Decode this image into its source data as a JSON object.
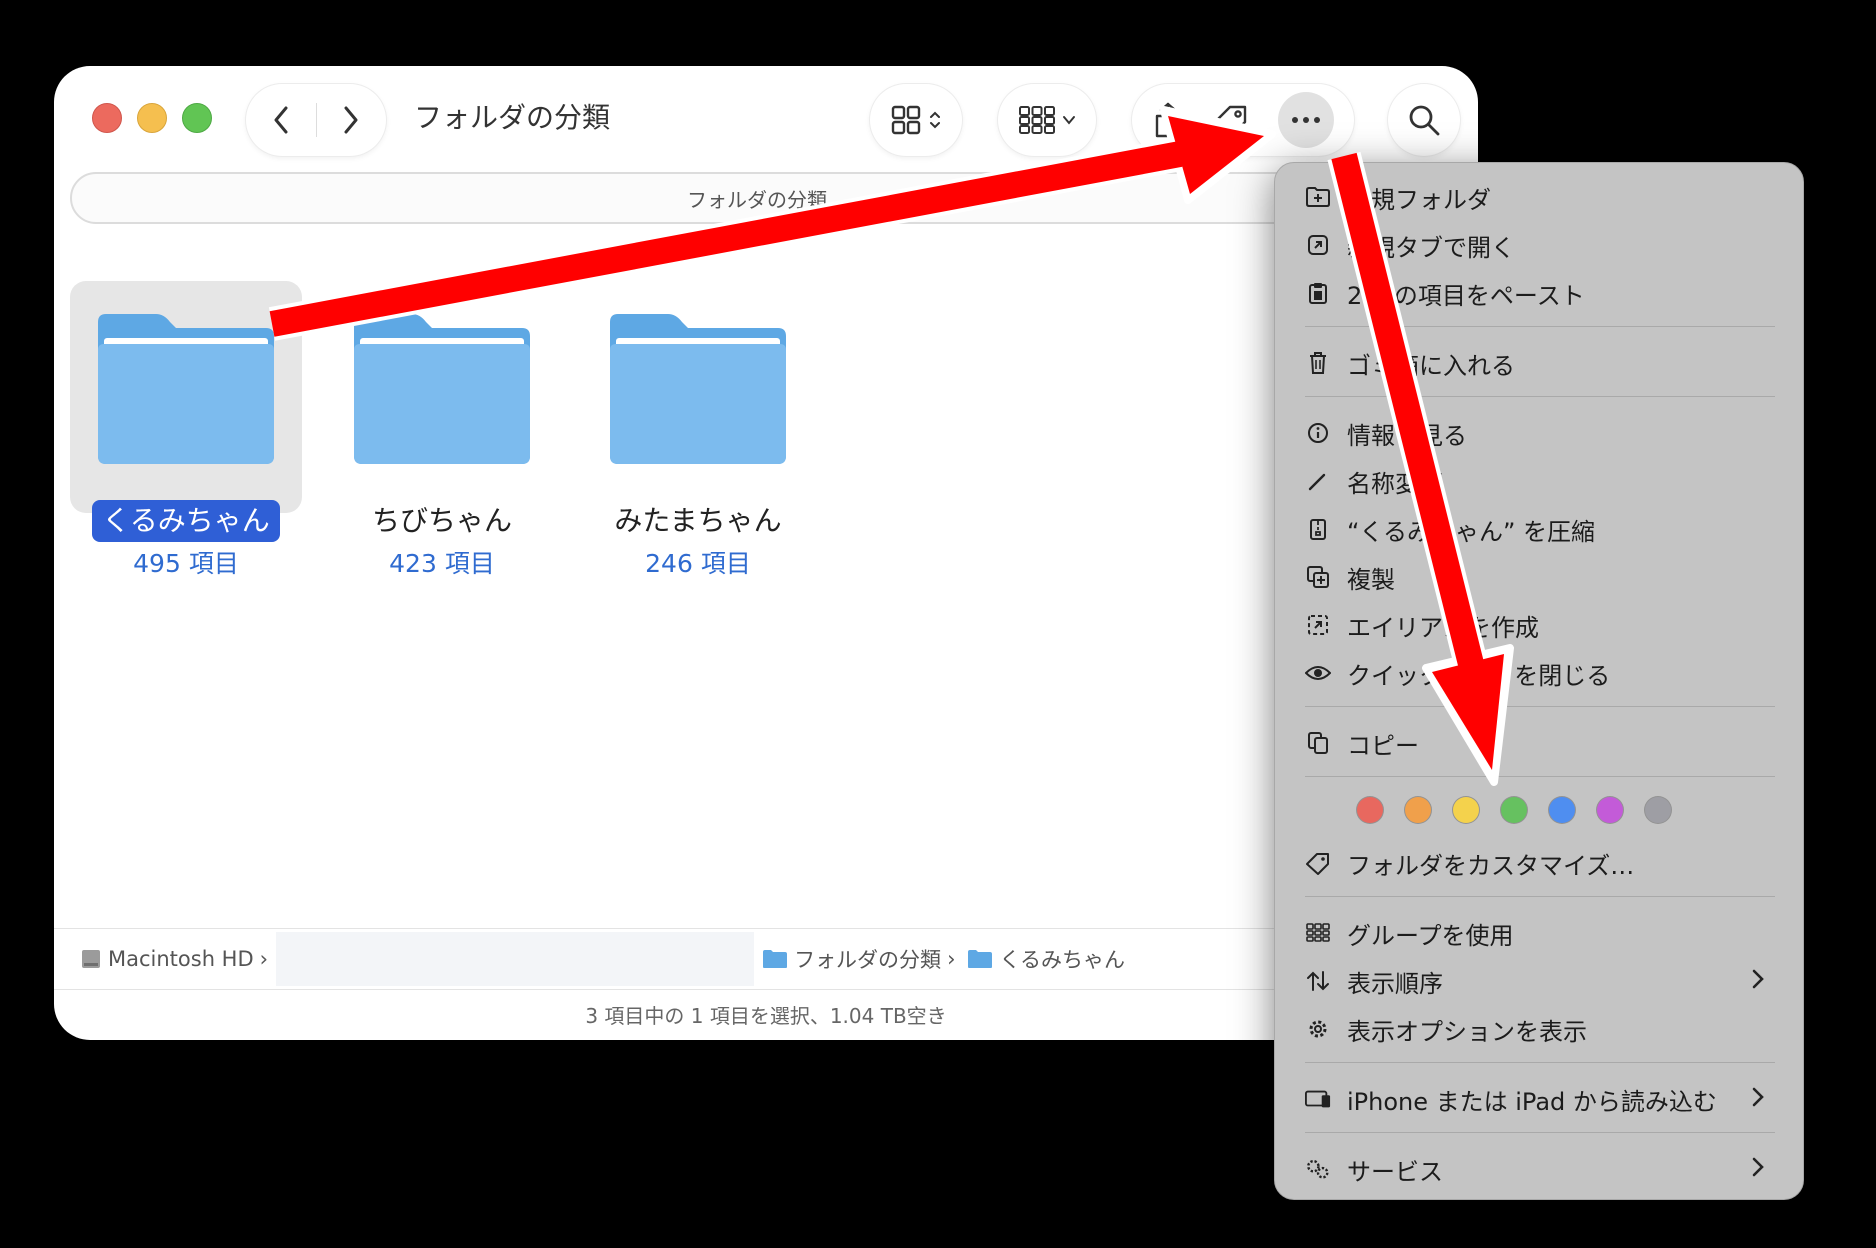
{
  "window": {
    "title": "フォルダの分類",
    "path_bar": "フォルダの分類",
    "status": "3 項目中の 1 項目を選択、1.04 TB空き"
  },
  "folders": [
    {
      "name": "くるみちゃん",
      "count": "495 項目",
      "selected": true
    },
    {
      "name": "ちびちゃん",
      "count": "423 項目",
      "selected": false
    },
    {
      "name": "みたまちゃん",
      "count": "246 項目",
      "selected": false
    }
  ],
  "breadcrumb": {
    "disk": "Macintosh HD",
    "sep": "›",
    "folder1": "フォルダの分類",
    "folder2": "くるみちゃん"
  },
  "menu": {
    "new_folder": "新規フォルダ",
    "open_new_tab": "新規タブで開く",
    "paste": "2 個の項目をペースト",
    "trash": "ゴミ箱に入れる",
    "get_info": "情報を見る",
    "rename": "名称変更",
    "compress": "“くるみちゃん” を圧縮",
    "duplicate": "複製",
    "make_alias": "エイリアスを作成",
    "quick_look": "クイックルックを閉じる",
    "copy": "コピー",
    "tags_label": "フォルダをカスタマイズ…",
    "use_groups": "グループを使用",
    "sort_by": "表示順序",
    "show_view_options": "表示オプションを表示",
    "import_iphone": "iPhone または iPad から読み込む",
    "services": "サービス"
  },
  "tag_colors": [
    "#e8685f",
    "#f0a04b",
    "#f4d24c",
    "#66c160",
    "#4f8ef0",
    "#c35bd8",
    "#9e9ea4"
  ],
  "colors": {
    "accent": "#2f5fd6",
    "annotation_arrow": "#ff0000"
  }
}
